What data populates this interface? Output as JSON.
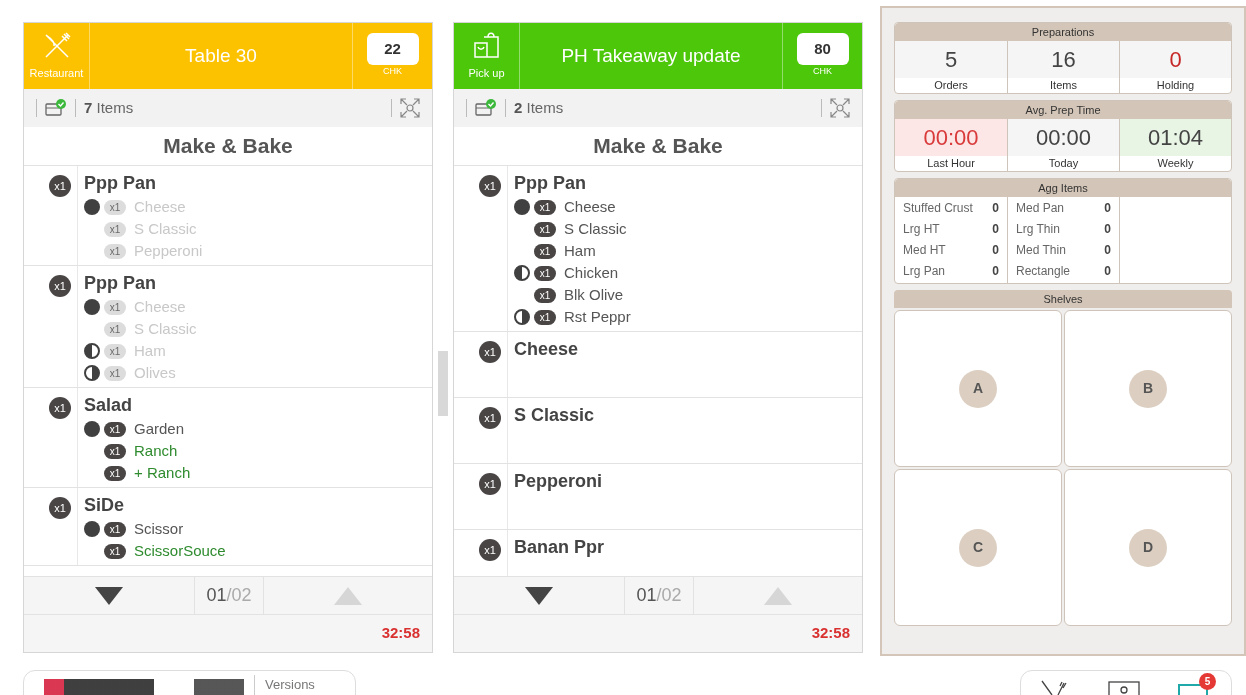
{
  "orders": [
    {
      "kind": "restaurant",
      "type_label": "Restaurant",
      "title": "Table 30",
      "check": "22",
      "check_label": "CHK",
      "items_count": "7",
      "items_label": "Items",
      "section": "Make & Bake",
      "items": [
        {
          "qty": "x1",
          "name": "Ppp Pan",
          "modifiers": [
            {
              "kind": "full",
              "qty": "x1",
              "name": "Cheese",
              "done": true
            },
            {
              "kind": "plain",
              "qty": "x1",
              "name": "S Classic",
              "done": true
            },
            {
              "kind": "plain",
              "qty": "x1",
              "name": "Pepperoni",
              "done": true
            }
          ]
        },
        {
          "qty": "x1",
          "name": "Ppp Pan",
          "modifiers": [
            {
              "kind": "full",
              "qty": "x1",
              "name": "Cheese",
              "done": true
            },
            {
              "kind": "plain",
              "qty": "x1",
              "name": "S Classic",
              "done": true
            },
            {
              "kind": "half_left",
              "qty": "x1",
              "name": "Ham",
              "done": true
            },
            {
              "kind": "half_right",
              "qty": "x1",
              "name": "Olives",
              "done": true
            }
          ]
        },
        {
          "qty": "x1",
          "name": "Salad",
          "modifiers": [
            {
              "kind": "full",
              "qty": "x1",
              "name": "Garden",
              "done": false
            },
            {
              "kind": "plain",
              "qty": "x1",
              "name": "Ranch",
              "done": false,
              "color": "#2e8b2e"
            },
            {
              "kind": "plain",
              "qty": "x1",
              "name": "+ Ranch",
              "done": false,
              "color": "#2e8b2e"
            }
          ]
        },
        {
          "qty": "x1",
          "name": "SiDe",
          "modifiers": [
            {
              "kind": "full",
              "qty": "x1",
              "name": "Scissor",
              "done": false
            },
            {
              "kind": "plain",
              "qty": "x1",
              "name": "ScissorSouce",
              "done": false,
              "color": "#2e8b2e"
            }
          ]
        }
      ],
      "page_current": "01",
      "page_total": "/02",
      "can_down": true,
      "can_up": false,
      "timer": "32:58"
    },
    {
      "kind": "pickup",
      "type_label": "Pick up",
      "title": "PH Takeaway update",
      "check": "80",
      "check_label": "CHK",
      "items_count": "2",
      "items_label": "Items",
      "section": "Make & Bake",
      "items": [
        {
          "qty": "x1",
          "name": "Ppp Pan",
          "modifiers": [
            {
              "kind": "full",
              "qty": "x1",
              "name": "Cheese",
              "done": false
            },
            {
              "kind": "plain",
              "qty": "x1",
              "name": "S Classic",
              "done": false
            },
            {
              "kind": "plain",
              "qty": "x1",
              "name": "Ham",
              "done": false
            },
            {
              "kind": "half_left",
              "qty": "x1",
              "name": "Chicken",
              "done": false
            },
            {
              "kind": "plain",
              "qty": "x1",
              "name": "Blk Olive",
              "done": false
            },
            {
              "kind": "half_right",
              "qty": "x1",
              "name": "Rst Peppr",
              "done": false
            }
          ]
        },
        {
          "qty": "x1",
          "name": "Cheese"
        },
        {
          "qty": "x1",
          "name": "S Classic"
        },
        {
          "qty": "x1",
          "name": "Pepperoni"
        },
        {
          "qty": "x1",
          "name": "Banan Ppr"
        }
      ],
      "page_current": "01",
      "page_total": "/02",
      "can_down": true,
      "can_up": false,
      "timer": "32:58"
    }
  ],
  "preparations": {
    "title": "Preparations",
    "cells": [
      {
        "value": "5",
        "label": "Orders",
        "kind": "neutral"
      },
      {
        "value": "16",
        "label": "Items",
        "kind": "neutral"
      },
      {
        "value": "0",
        "label": "Holding",
        "kind": "red_text"
      }
    ]
  },
  "avg_prep_time": {
    "title": "Avg. Prep Time",
    "cells": [
      {
        "value": "00:00",
        "label": "Last Hour",
        "kind": "red"
      },
      {
        "value": "00:00",
        "label": "Today",
        "kind": "neutral"
      },
      {
        "value": "01:04",
        "label": "Weekly",
        "kind": "green"
      }
    ]
  },
  "agg_items": {
    "title": "Agg Items",
    "columns": [
      [
        {
          "name": "Stuffed Crust",
          "count": "0"
        },
        {
          "name": "Lrg HT",
          "count": "0"
        },
        {
          "name": "Med HT",
          "count": "0"
        },
        {
          "name": "Lrg Pan",
          "count": "0"
        }
      ],
      [
        {
          "name": "Med Pan",
          "count": "0"
        },
        {
          "name": "Lrg Thin",
          "count": "0"
        },
        {
          "name": "Med Thin",
          "count": "0"
        },
        {
          "name": "Rectangle",
          "count": "0"
        }
      ]
    ]
  },
  "shelves": {
    "title": "Shelves",
    "items": [
      "A",
      "B",
      "C",
      "D"
    ]
  },
  "bottom_bar": {
    "versions": "Versions",
    "notifications": "5"
  }
}
